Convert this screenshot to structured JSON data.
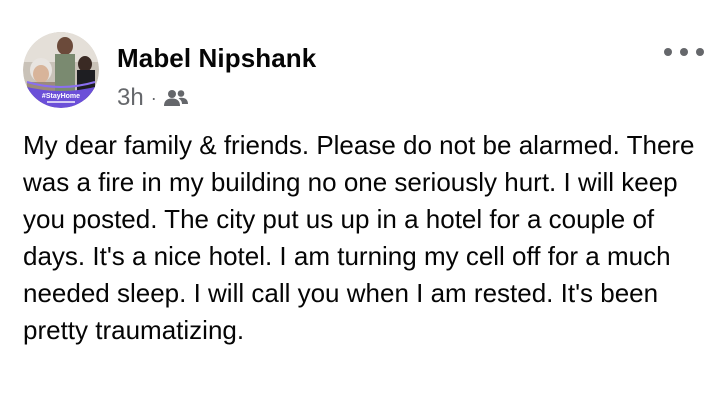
{
  "post": {
    "author": {
      "name": "Mabel Nipshank",
      "avatar_frame_text": "#StayHome"
    },
    "timestamp": "3h",
    "separator": "·",
    "audience_icon": "friends-icon",
    "more_icon": "more-options-icon",
    "body": "My dear family & friends. Please do not be alarmed. There was a fire in my building no one seriously hurt. I will keep you posted. The city put us up in a hotel for a couple of days. It's a nice hotel. I am turning my cell off for a much needed sleep. I will call you when I am rested. It's been pretty traumatizing."
  },
  "colors": {
    "text_primary": "#050505",
    "text_secondary": "#65676b",
    "frame_purple": "#6b4fd8"
  }
}
